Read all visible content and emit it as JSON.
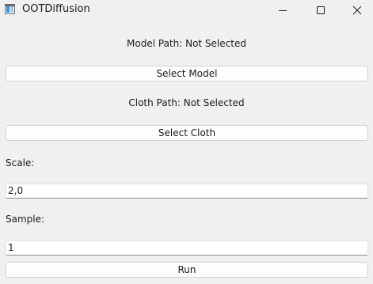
{
  "window": {
    "title": "OOTDiffusion",
    "icon": "app-window-icon",
    "controls": {
      "minimize": "minimize-icon",
      "maximize": "maximize-icon",
      "close": "close-icon"
    }
  },
  "model": {
    "path_label": "Model Path: Not Selected",
    "select_button": "Select Model"
  },
  "cloth": {
    "path_label": "Cloth Path: Not Selected",
    "select_button": "Select Cloth"
  },
  "scale": {
    "label": "Scale:",
    "value": "2,0"
  },
  "sample": {
    "label": "Sample:",
    "value": "1"
  },
  "run": {
    "button": "Run"
  }
}
